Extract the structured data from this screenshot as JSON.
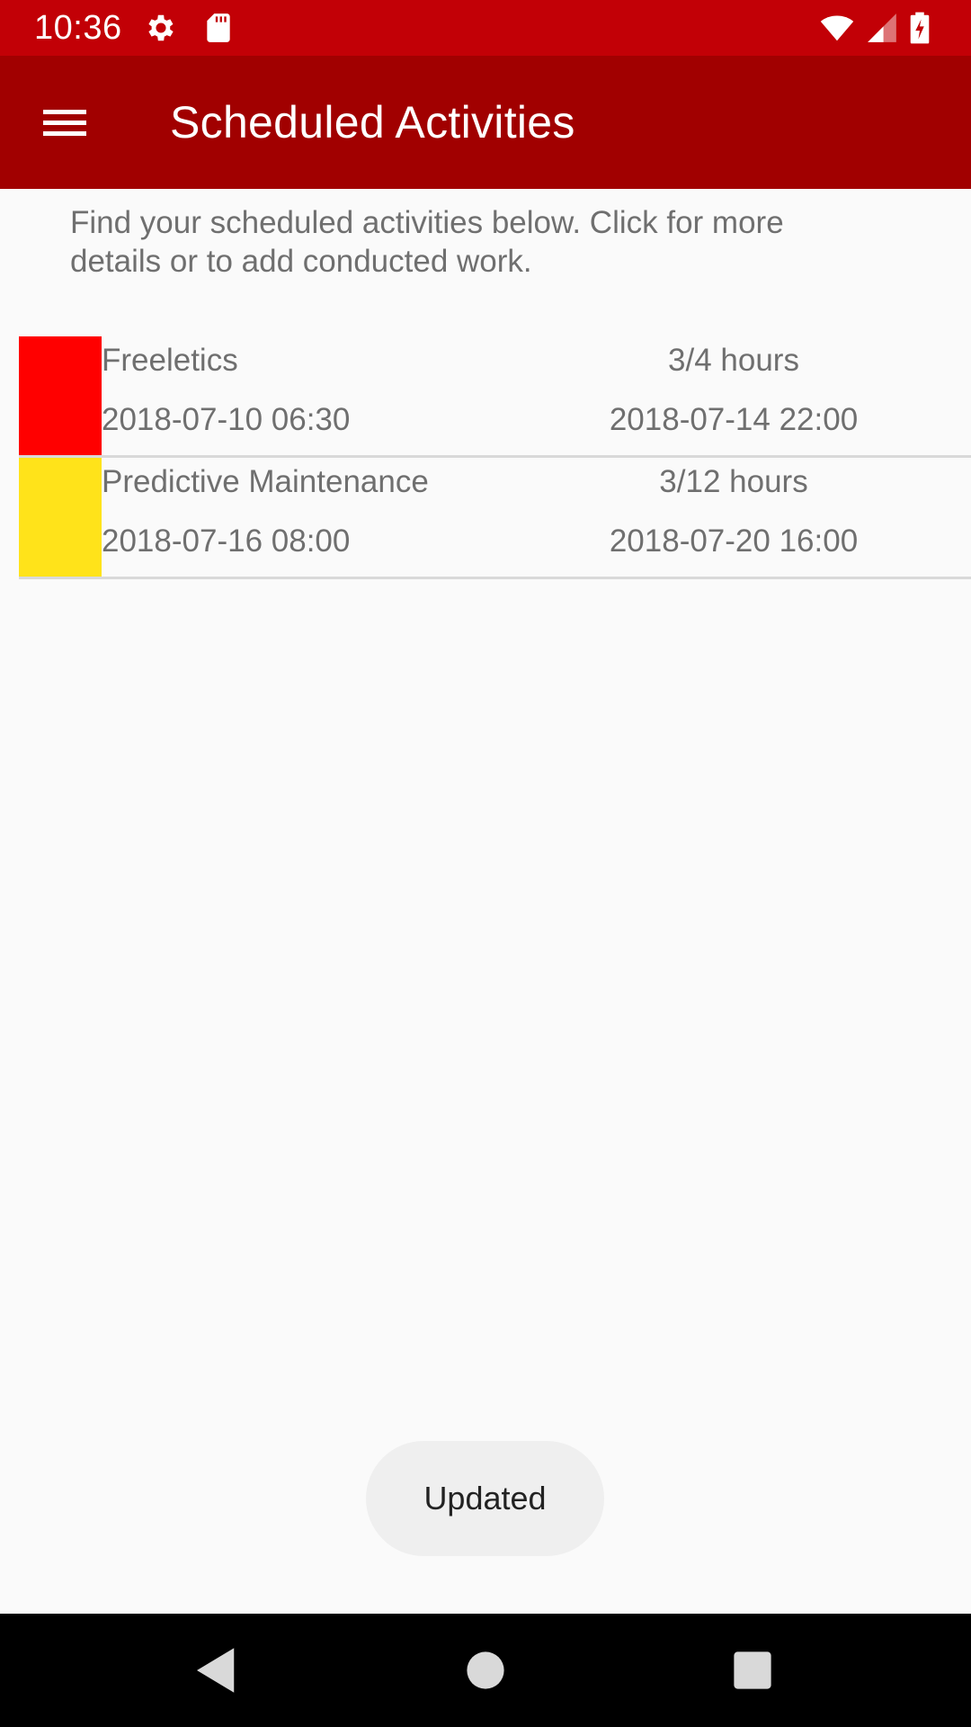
{
  "status_bar": {
    "time": "10:36",
    "icons_left": [
      "gear-icon",
      "sd-card-icon"
    ],
    "icons_right": [
      "wifi-icon",
      "cell-signal-icon",
      "battery-charging-icon"
    ],
    "color": "#c20006"
  },
  "app_bar": {
    "title": "Scheduled Activities",
    "menu_icon": "hamburger-menu-icon",
    "color": "#a10000"
  },
  "intro": {
    "text": "Find your scheduled activities below. Click for more details or to add conducted work."
  },
  "activities": [
    {
      "color": "#ff0000",
      "name": "Freeletics",
      "hours": "3/4 hours",
      "start": "2018-07-10 06:30",
      "end": "2018-07-14 22:00"
    },
    {
      "color": "#ffe31a",
      "name": "Predictive Maintenance",
      "hours": "3/12 hours",
      "start": "2018-07-16 08:00",
      "end": "2018-07-20 16:00"
    }
  ],
  "toast": {
    "text": "Updated"
  },
  "nav_bar": {
    "buttons": [
      "back-icon",
      "home-icon",
      "recents-icon"
    ]
  }
}
